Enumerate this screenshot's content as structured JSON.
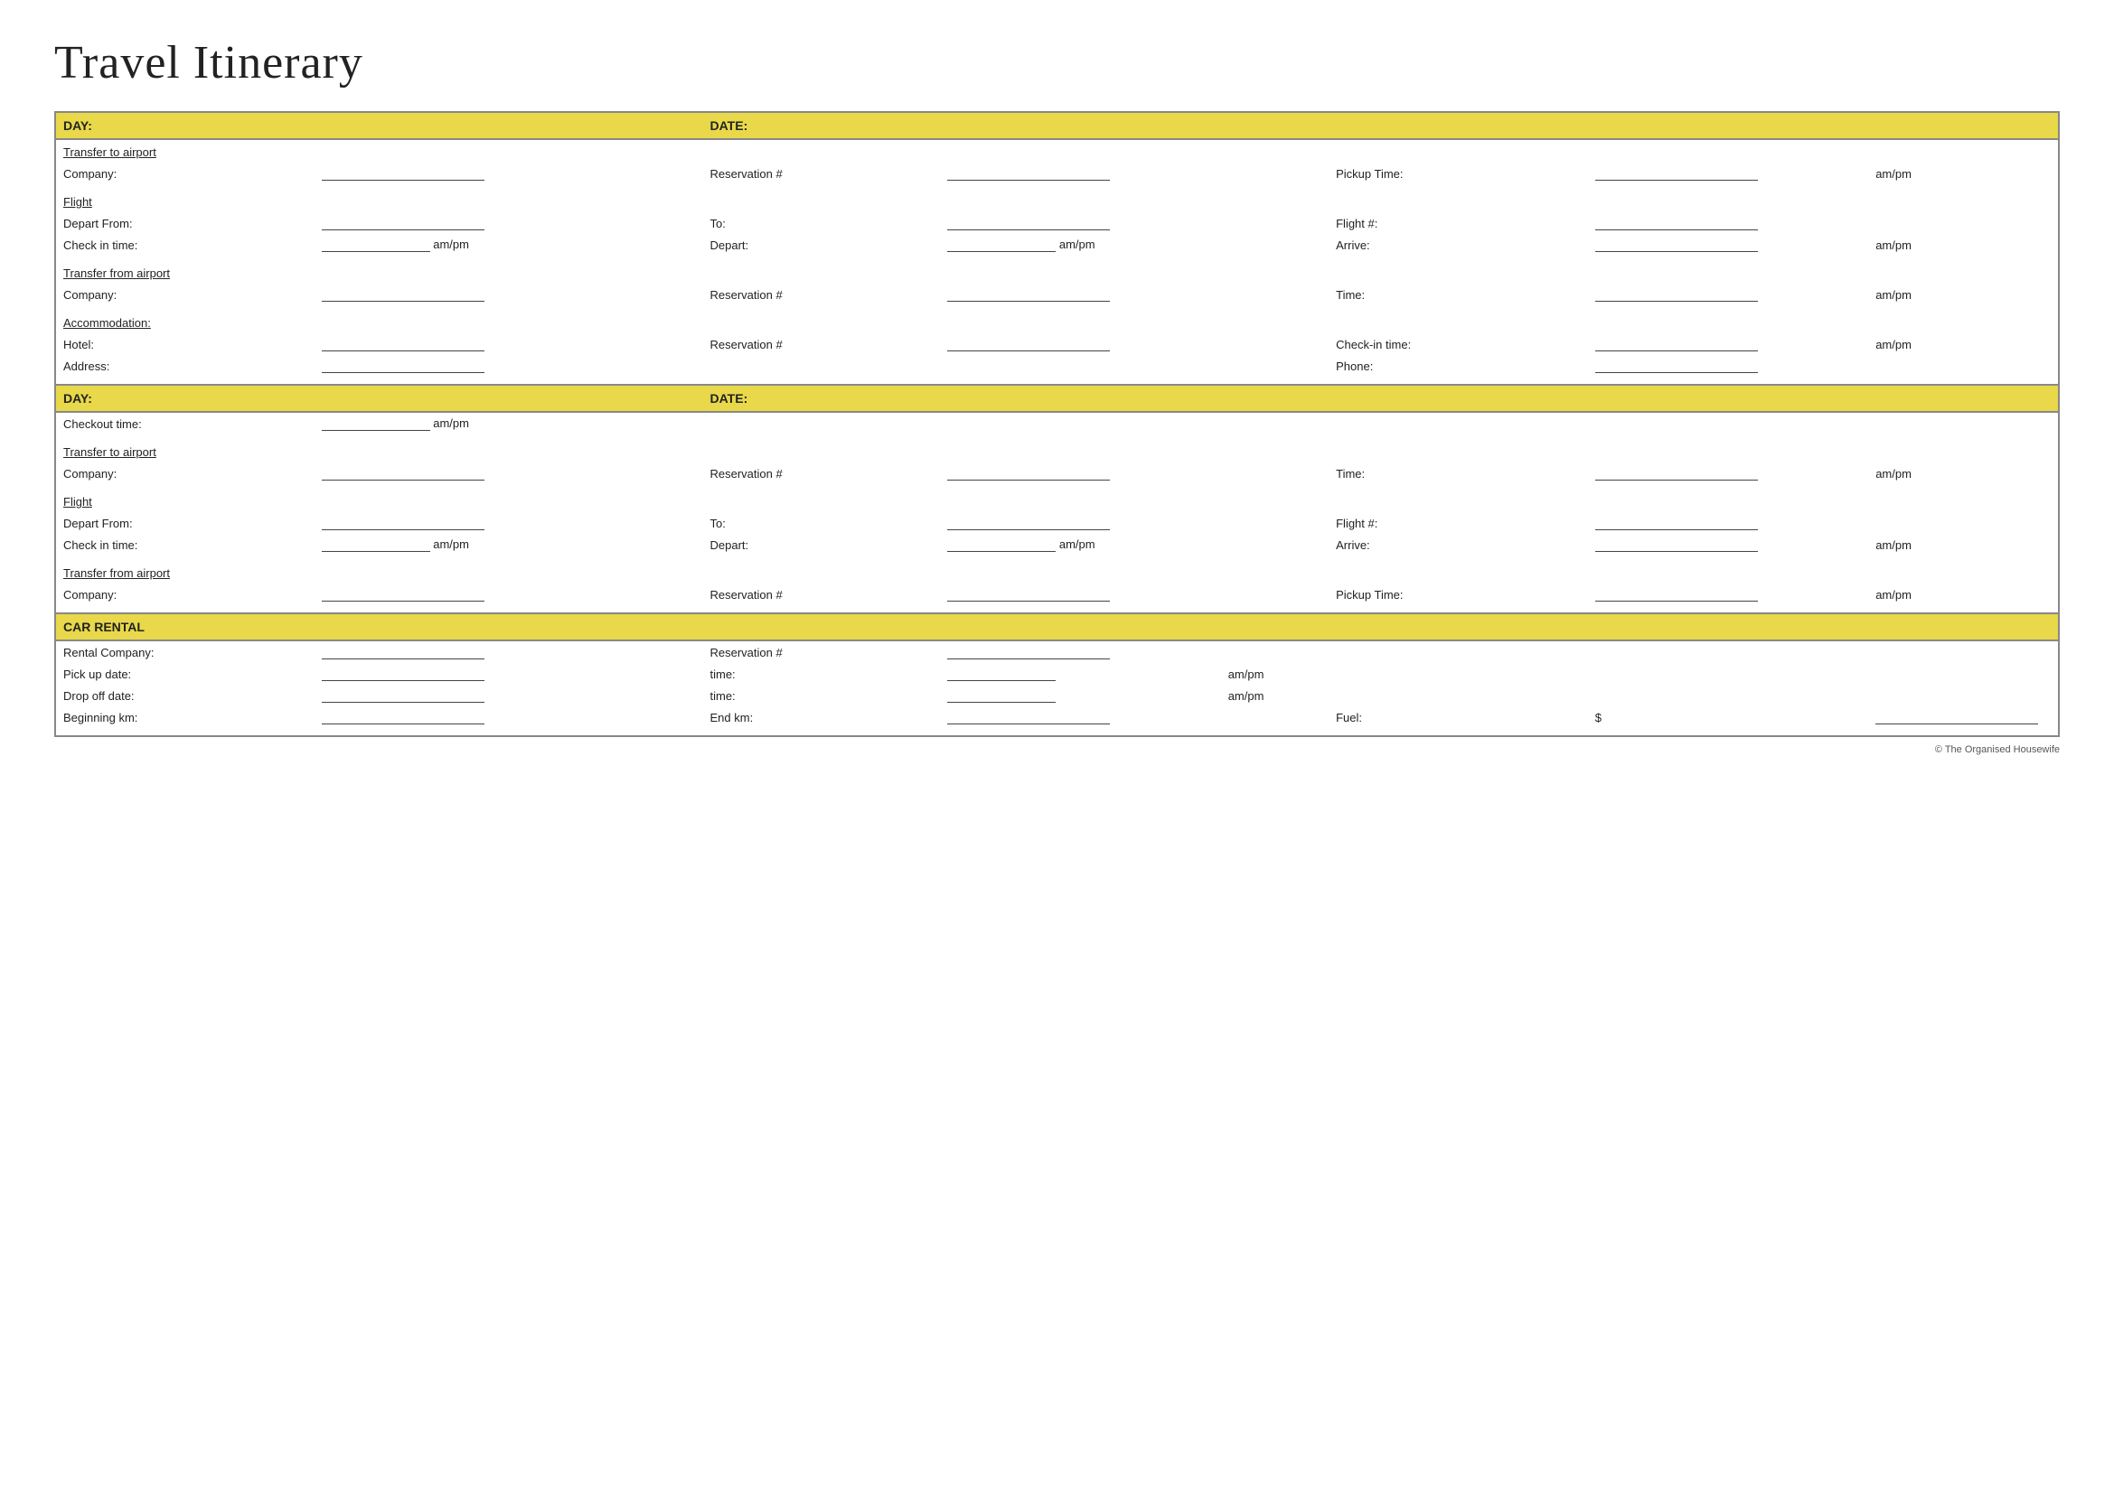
{
  "title": "Travel Itinerary",
  "copyright": "© The Organised Housewife",
  "section1": {
    "day_label": "DAY:",
    "date_label": "DATE:",
    "transfer_to_airport": "Transfer to airport",
    "company_label": "Company:",
    "reservation_label": "Reservation #",
    "pickup_time_label": "Pickup Time:",
    "ampm": "am/pm",
    "flight_label": "Flight",
    "depart_from_label": "Depart From:",
    "to_label": "To:",
    "flight_num_label": "Flight #:",
    "check_in_label": "Check in time:",
    "depart_label": "Depart:",
    "arrive_label": "Arrive:",
    "transfer_from_airport": "Transfer from airport",
    "time_label": "Time:",
    "accommodation_label": "Accommodation:",
    "hotel_label": "Hotel:",
    "checkin_time_label": "Check-in time:",
    "address_label": "Address:",
    "phone_label": "Phone:"
  },
  "section2": {
    "day_label": "DAY:",
    "date_label": "DATE:",
    "checkout_label": "Checkout time:",
    "transfer_to_airport": "Transfer to airport",
    "company_label": "Company:",
    "reservation_label": "Reservation #",
    "time_label": "Time:",
    "ampm": "am/pm",
    "flight_label": "Flight",
    "depart_from_label": "Depart From:",
    "to_label": "To:",
    "flight_num_label": "Flight #:",
    "check_in_label": "Check in time:",
    "depart_label": "Depart:",
    "arrive_label": "Arrive:",
    "transfer_from_airport": "Transfer from airport",
    "company2_label": "Company:",
    "reservation2_label": "Reservation #",
    "pickup_time_label": "Pickup Time:"
  },
  "car_rental": {
    "section_label": "CAR RENTAL",
    "rental_company_label": "Rental Company:",
    "reservation_label": "Reservation #",
    "pickup_date_label": "Pick up date:",
    "time_label": "time:",
    "dropoff_label": "Drop off date:",
    "time2_label": "time:",
    "begin_km_label": "Beginning km:",
    "end_km_label": "End km:",
    "fuel_label": "Fuel:",
    "dollar": "$",
    "ampm": "am/pm"
  }
}
